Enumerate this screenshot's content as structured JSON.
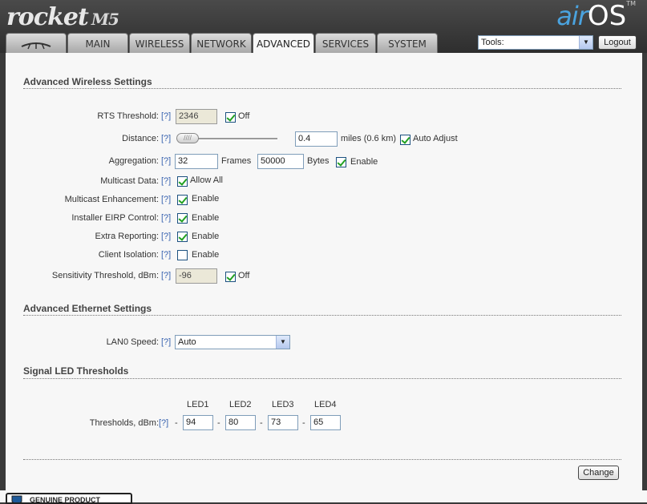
{
  "header": {
    "logo_text": "rocket",
    "logo_model": "M5",
    "brand_air": "air",
    "brand_os": "OS",
    "brand_tm": "TM"
  },
  "tabs": [
    {
      "label": "",
      "icon": "ubiquiti-logo-icon"
    },
    {
      "label": "MAIN"
    },
    {
      "label": "WIRELESS"
    },
    {
      "label": "NETWORK"
    },
    {
      "label": "ADVANCED",
      "active": true
    },
    {
      "label": "SERVICES"
    },
    {
      "label": "SYSTEM"
    }
  ],
  "tools": {
    "selected": "Tools:"
  },
  "logout_label": "Logout",
  "wireless": {
    "title": "Advanced Wireless Settings",
    "help": "[?]",
    "rts": {
      "label": "RTS Threshold:",
      "value": "2346",
      "off_label": "Off",
      "off_checked": true
    },
    "distance": {
      "label": "Distance:",
      "value": "0.4",
      "unit": "miles (0.6 km)",
      "auto_label": "Auto Adjust",
      "auto_checked": true,
      "slider_glyph": "////"
    },
    "aggregation": {
      "label": "Aggregation:",
      "frames": "32",
      "frames_unit": "Frames",
      "bytes": "50000",
      "bytes_unit": "Bytes",
      "enable_label": "Enable",
      "enable_checked": true
    },
    "multicast": {
      "label": "Multicast Data:",
      "option": "Allow All",
      "checked": true
    },
    "multicast_enh": {
      "label": "Multicast Enhancement:",
      "option": "Enable",
      "checked": true
    },
    "eirp": {
      "label": "Installer EIRP Control:",
      "option": "Enable",
      "checked": true
    },
    "extra": {
      "label": "Extra Reporting:",
      "option": "Enable",
      "checked": true
    },
    "isolation": {
      "label": "Client Isolation:",
      "option": "Enable",
      "checked": false
    },
    "sensitivity": {
      "label": "Sensitivity Threshold, dBm:",
      "value": "-96",
      "off_label": "Off",
      "off_checked": true
    }
  },
  "ethernet": {
    "title": "Advanced Ethernet Settings",
    "lan0": {
      "label": "LAN0 Speed:",
      "value": "Auto"
    }
  },
  "led": {
    "title": "Signal LED Thresholds",
    "label": "Thresholds, dBm:",
    "headers": [
      "LED1",
      "LED2",
      "LED3",
      "LED4"
    ],
    "values": [
      "94",
      "80",
      "73",
      "65"
    ],
    "sep": "-"
  },
  "change_label": "Change",
  "footer": {
    "badge": "GENUINE PRODUCT"
  }
}
